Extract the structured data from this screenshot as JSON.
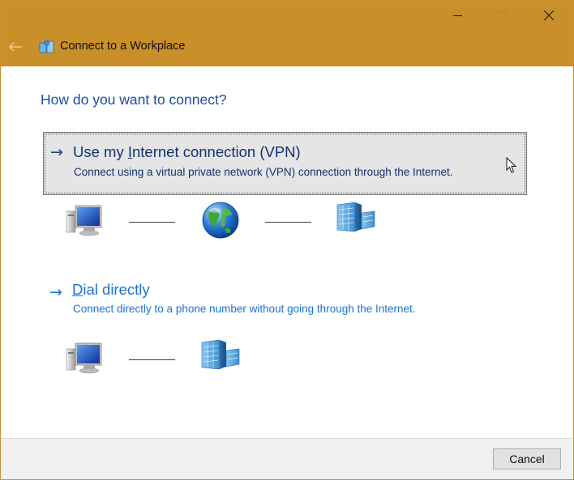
{
  "window": {
    "title": "Connect to a Workplace",
    "colors": {
      "titlebar": "#c98f29",
      "heading": "#1b4ea3",
      "link": "#1b73d1",
      "selected_bg": "#e5e5e5"
    }
  },
  "heading": "How do you want to connect?",
  "options": [
    {
      "arrow": "→",
      "title_before": "Use my ",
      "title_underlined": "I",
      "title_after": "nternet connection (VPN)",
      "description": "Connect using a virtual private network (VPN) connection through the Internet.",
      "diagram_icons": [
        "computer-icon",
        "globe-icon",
        "office-building-icon"
      ]
    },
    {
      "arrow": "→",
      "title_underlined": "D",
      "title_after": "ial directly",
      "description": "Connect directly to a phone number without going through the Internet.",
      "diagram_icons": [
        "computer-icon",
        "office-building-icon"
      ]
    }
  ],
  "footer": {
    "cancel_label": "Cancel"
  },
  "icons": {
    "back": "back-arrow-icon",
    "minimize": "minimize-icon",
    "maximize": "maximize-icon",
    "close": "close-icon",
    "app": "network-connection-icon",
    "cursor": "mouse-cursor-icon"
  }
}
